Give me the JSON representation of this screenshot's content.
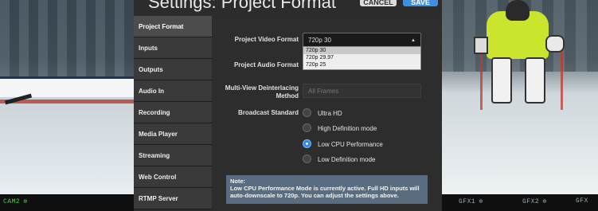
{
  "panel": {
    "title": "Settings: Project Format",
    "cancel_label": "CANCEL",
    "save_label": "SAVE"
  },
  "sidebar": {
    "items": [
      {
        "label": "Project Format",
        "active": true
      },
      {
        "label": "Inputs"
      },
      {
        "label": "Outputs"
      },
      {
        "label": "Audio In"
      },
      {
        "label": "Recording"
      },
      {
        "label": "Media Player"
      },
      {
        "label": "Streaming"
      },
      {
        "label": "Web Control"
      },
      {
        "label": "RTMP Server"
      }
    ]
  },
  "form": {
    "video_format_label": "Project Video Format",
    "video_format_value": "720p 30",
    "video_format_options": [
      "720p 30",
      "720p 29.97",
      "720p 25"
    ],
    "audio_format_label": "Project Audio Format",
    "deinterlace_label_line1": "Multi-View Deinterlacing",
    "deinterlace_label_line2": "Method",
    "deinterlace_placeholder": "All Frames",
    "broadcast_label": "Broadcast Standard",
    "broadcast_options": [
      {
        "label": "Ultra HD",
        "selected": false
      },
      {
        "label": "High Definition mode",
        "selected": false
      },
      {
        "label": "Low CPU Performance",
        "selected": true
      },
      {
        "label": "Low Definition mode",
        "selected": false
      }
    ]
  },
  "note": {
    "title": "Note:",
    "line1": "Low CPU Performance Mode is currently active. Full HD inputs will",
    "line2": "auto-downscale to 720p. You can adjust the settings above."
  },
  "multiview": {
    "cam_left": "CAM2",
    "gfx1": "GFX1",
    "gfx2": "GFX2",
    "gfx3": "GFX"
  },
  "colors": {
    "accent": "#2e89e3",
    "note_bg": "#5a6c7f",
    "cam_active": "#44d044"
  }
}
